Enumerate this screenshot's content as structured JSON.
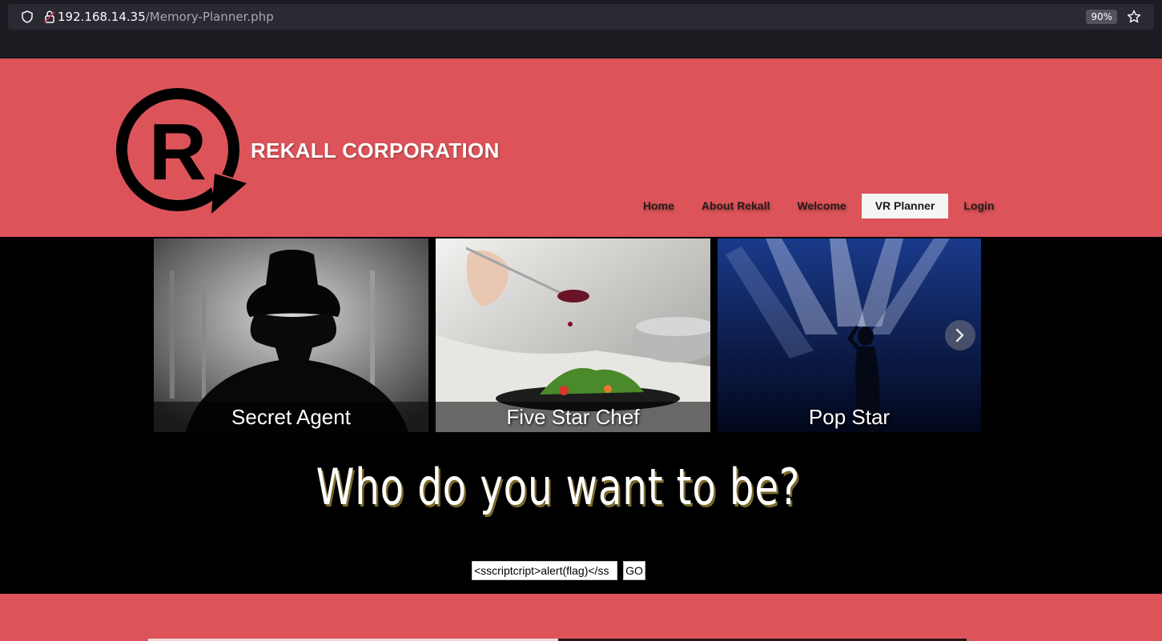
{
  "browser": {
    "url_host": "192.168.14.35",
    "url_path": "/Memory-Planner.php",
    "zoom": "90%"
  },
  "header": {
    "brand": "REKALL CORPORATION",
    "logo_letter": "R",
    "nav": [
      {
        "label": "Home",
        "active": false
      },
      {
        "label": "About Rekall",
        "active": false
      },
      {
        "label": "Welcome",
        "active": false
      },
      {
        "label": "VR Planner",
        "active": true
      },
      {
        "label": "Login",
        "active": false
      }
    ]
  },
  "carousel": {
    "slides": [
      {
        "caption": "Secret Agent"
      },
      {
        "caption": "Five Star Chef"
      },
      {
        "caption": "Pop Star"
      }
    ]
  },
  "main": {
    "headline": "Who do you want to be?",
    "input_value": "<sscriptcript>alert(flag)</ss",
    "go_label": "GO"
  },
  "colors": {
    "brand_red": "#dc545a",
    "browser_dark": "#1c1b22"
  }
}
